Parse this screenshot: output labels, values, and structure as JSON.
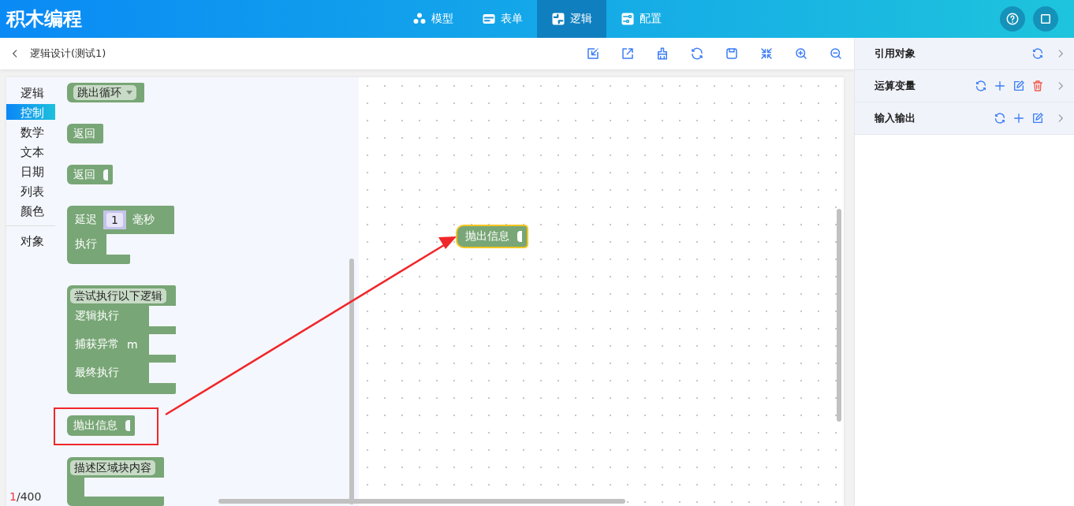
{
  "app": {
    "title": "积木编程"
  },
  "nav": [
    {
      "label": "模型",
      "selected": false
    },
    {
      "label": "表单",
      "selected": false
    },
    {
      "label": "逻辑",
      "selected": true
    },
    {
      "label": "配置",
      "selected": false
    }
  ],
  "page": {
    "title": "逻辑设计(测试1)"
  },
  "category_groups": [
    {
      "items": [
        {
          "label": "逻辑",
          "selected": false
        },
        {
          "label": "控制",
          "selected": true
        },
        {
          "label": "数学",
          "selected": false
        },
        {
          "label": "文本",
          "selected": false
        },
        {
          "label": "日期",
          "selected": false
        },
        {
          "label": "列表",
          "selected": false
        },
        {
          "label": "颜色",
          "selected": false
        }
      ]
    },
    {
      "items": [
        {
          "label": "对象",
          "selected": false
        }
      ]
    }
  ],
  "blocks": [
    {
      "kind": "dropdown",
      "label": "跳出循环"
    },
    {
      "kind": "plain",
      "label": "返回"
    },
    {
      "kind": "value",
      "label": "返回"
    },
    {
      "kind": "delay",
      "label": "延迟",
      "value": "1",
      "unit": "毫秒",
      "body": "执行"
    },
    {
      "kind": "try",
      "label": "尝试执行以下逻辑",
      "rows": [
        {
          "label": "逻辑执行"
        },
        {
          "label": "捕获异常",
          "variable": "m"
        },
        {
          "label": "最终执行"
        }
      ]
    },
    {
      "kind": "value",
      "label": "抛出信息",
      "highlighted": true
    },
    {
      "kind": "comment",
      "label": "描述区域块内容"
    }
  ],
  "canvas_block": {
    "label": "抛出信息",
    "selected": true
  },
  "counter": {
    "current": "1",
    "total": "/400"
  },
  "panels": [
    {
      "title": "引用对象",
      "actions": [
        {
          "kind": "refresh"
        }
      ]
    },
    {
      "title": "运算变量",
      "actions": [
        {
          "kind": "refresh"
        },
        {
          "kind": "add"
        },
        {
          "kind": "edit"
        },
        {
          "kind": "delete"
        }
      ]
    },
    {
      "title": "输入输出",
      "actions": [
        {
          "kind": "refresh"
        },
        {
          "kind": "add"
        },
        {
          "kind": "edit"
        }
      ]
    }
  ]
}
